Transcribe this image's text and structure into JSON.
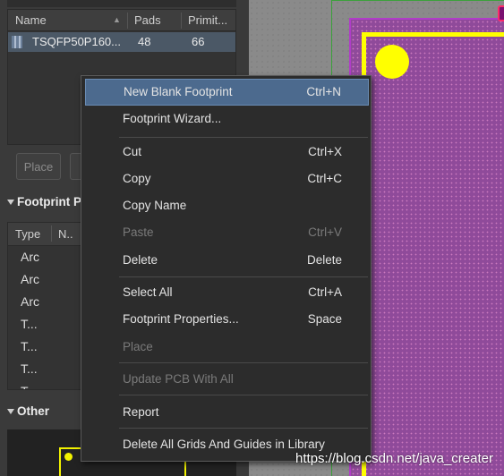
{
  "library_list": {
    "columns": [
      "Name",
      "Pads",
      "Primit..."
    ],
    "rows": [
      {
        "name": "TSQFP50P160...",
        "pads": "48",
        "primitives": "66"
      }
    ]
  },
  "buttons": {
    "place": "Place"
  },
  "footprint_primitives": {
    "title": "Footprint P",
    "columns": [
      "Type",
      "N.."
    ],
    "rows": [
      "Arc",
      "Arc",
      "Arc",
      "T...",
      "T...",
      "T...",
      "T..."
    ]
  },
  "other": {
    "title": "Other"
  },
  "context_menu": {
    "items": [
      {
        "label": "New Blank Footprint",
        "shortcut": "Ctrl+N",
        "highlighted": true,
        "disabled": false
      },
      {
        "label": "Footprint Wizard...",
        "shortcut": "",
        "highlighted": false,
        "disabled": false
      },
      {
        "label": "Cut",
        "shortcut": "Ctrl+X",
        "highlighted": false,
        "disabled": false
      },
      {
        "label": "Copy",
        "shortcut": "Ctrl+C",
        "highlighted": false,
        "disabled": false
      },
      {
        "label": "Copy Name",
        "shortcut": "",
        "highlighted": false,
        "disabled": false
      },
      {
        "label": "Paste",
        "shortcut": "Ctrl+V",
        "highlighted": false,
        "disabled": true
      },
      {
        "label": "Delete",
        "shortcut": "Delete",
        "highlighted": false,
        "disabled": false
      },
      {
        "label": "Select All",
        "shortcut": "Ctrl+A",
        "highlighted": false,
        "disabled": false
      },
      {
        "label": "Footprint Properties...",
        "shortcut": "Space",
        "highlighted": false,
        "disabled": false
      },
      {
        "label": "Place",
        "shortcut": "",
        "highlighted": false,
        "disabled": true
      },
      {
        "label": "Update PCB With All",
        "shortcut": "",
        "highlighted": false,
        "disabled": true
      },
      {
        "label": "Report",
        "shortcut": "",
        "highlighted": false,
        "disabled": false
      },
      {
        "label": "Delete All Grids And Guides in Library",
        "shortcut": "",
        "highlighted": false,
        "disabled": false
      }
    ]
  },
  "watermark": "https://blog.csdn.net/java_creater",
  "colors": {
    "menu_highlight": "#4c6a8e",
    "pad_yellow": "#ffff00",
    "layer_magenta": "#8f4a9a",
    "board_green": "#3ca03c"
  }
}
